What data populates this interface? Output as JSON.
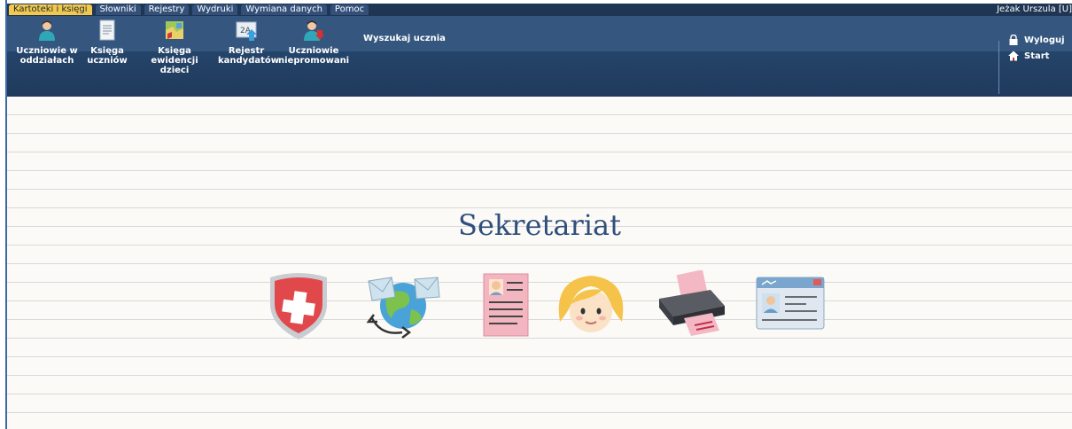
{
  "menu": {
    "items": [
      {
        "label": "Kartoteki i księgi",
        "active": true
      },
      {
        "label": "Słowniki",
        "active": false
      },
      {
        "label": "Rejestry",
        "active": false
      },
      {
        "label": "Wydruki",
        "active": false
      },
      {
        "label": "Wymiana danych",
        "active": false
      },
      {
        "label": "Pomoc",
        "active": false
      }
    ]
  },
  "user": {
    "name": "Jeżak Urszula [U]"
  },
  "toolbar": {
    "items": [
      {
        "label": "Uczniowie w\noddziałach",
        "icon": "student-icon"
      },
      {
        "label": "Księga\nuczniów",
        "icon": "book-icon"
      },
      {
        "label": "Księga\newidencji dzieci",
        "icon": "map-book-icon"
      },
      {
        "label": "Rejestr\nkandydatów",
        "icon": "register-2a-icon"
      },
      {
        "label": "Uczniowie\nniepromowani",
        "icon": "student-down-icon"
      }
    ],
    "search_label": "Wyszukaj ucznia"
  },
  "right_links": {
    "logout": "Wyloguj",
    "start": "Start"
  },
  "main": {
    "title": "Sekretariat",
    "icons": [
      "shield-plus-icon",
      "globe-mail-icon",
      "document-card-icon",
      "girl-face-icon",
      "printer-icon",
      "id-card-icon"
    ]
  },
  "colors": {
    "header_bg": "#1f3a5c",
    "menu_active": "#f2c94c",
    "title": "#2f4f7c"
  }
}
